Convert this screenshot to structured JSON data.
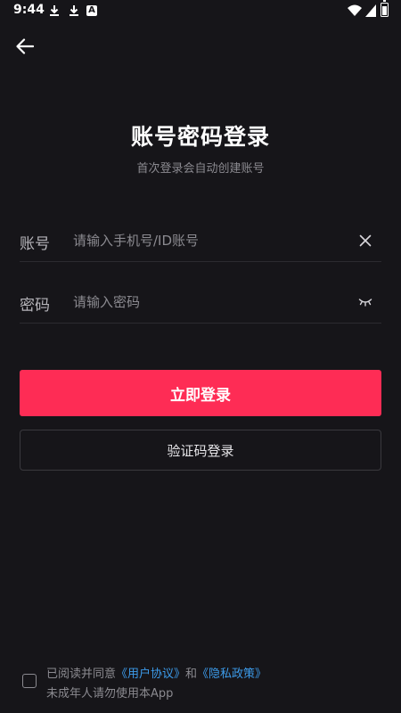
{
  "status_bar": {
    "time": "9:44",
    "app_icon_letter": "A"
  },
  "header": {
    "back_icon": "arrow-left-icon"
  },
  "title": "账号密码登录",
  "subtitle": "首次登录会自动创建账号",
  "account_field": {
    "label": "账号",
    "placeholder": "请输入手机号/ID账号",
    "value": "",
    "icon": "clear-icon"
  },
  "password_field": {
    "label": "密码",
    "placeholder": "请输入密码",
    "value": "",
    "icon": "eye-closed-icon"
  },
  "buttons": {
    "login": "立即登录",
    "code_login": "验证码登录"
  },
  "agreement": {
    "prefix": "已阅读并同意",
    "user_agreement": "《用户协议》",
    "conjunction": "和",
    "privacy_policy": "《隐私政策》",
    "line2": "未成年人请勿使用本App",
    "checked": false
  },
  "colors": {
    "background": "#161519",
    "primary": "#fe2c55",
    "link": "#3c9bea",
    "muted_text": "#8b8a90"
  }
}
